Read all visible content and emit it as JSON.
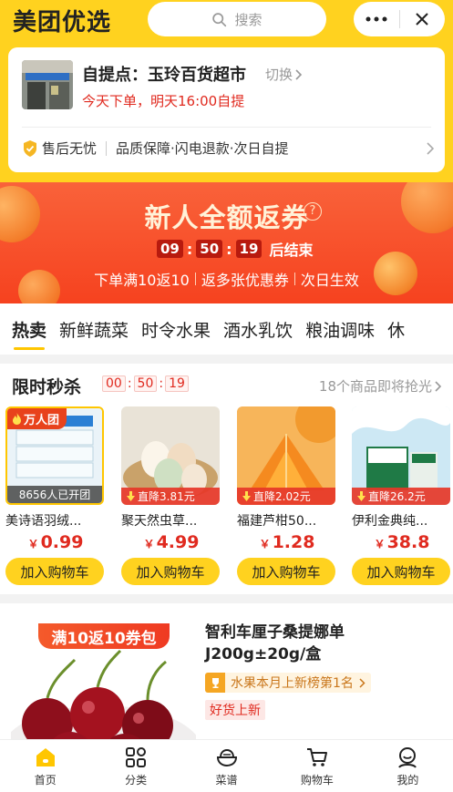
{
  "app": {
    "logo": "美团优选"
  },
  "search": {
    "placeholder": "搜索"
  },
  "pickup": {
    "title": "自提点：玉玲百货超市",
    "switch_label": "切换",
    "time_text": "今天下单，明天16:00自提"
  },
  "guarantee": {
    "label": "售后无忧",
    "detail": "品质保障·闪电退款·次日自提"
  },
  "banner": {
    "title": "新人全额返券",
    "help": "?",
    "countdown": {
      "h": "09",
      "m": "50",
      "s": "19",
      "end_label": "后结束"
    },
    "sub": [
      "下单满10返10",
      "返多张优惠券",
      "次日生效"
    ]
  },
  "tabs": [
    {
      "label": "热卖",
      "active": true
    },
    {
      "label": "新鲜蔬菜"
    },
    {
      "label": "时令水果"
    },
    {
      "label": "酒水乳饮"
    },
    {
      "label": "粮油调味"
    },
    {
      "label": "休"
    }
  ],
  "flash_sale": {
    "title": "限时秒杀",
    "countdown": {
      "h": "00",
      "m": "50",
      "s": "19"
    },
    "more_text": "18个商品即将抢光",
    "products": [
      {
        "name": "美诗语羽绒...",
        "price": "0.99",
        "tag": "8656人已开团",
        "group_badge": "万人团",
        "add_label": "加入购物车"
      },
      {
        "name": "聚天然虫草...",
        "price": "4.99",
        "tag": "直降3.81元",
        "add_label": "加入购物车"
      },
      {
        "name": "福建芦柑50...",
        "price": "1.28",
        "tag": "直降2.02元",
        "add_label": "加入购物车"
      },
      {
        "name": "伊利金典纯...",
        "price": "38.8",
        "tag": "直降26.2元",
        "add_label": "加入购物车"
      }
    ],
    "currency": "￥"
  },
  "featured": {
    "badge": "满10返10券包",
    "title": "智利车厘子桑提娜单J200g±20g/盒",
    "rank_text": "水果本月上新榜第1名",
    "tag": "好货上新"
  },
  "bottom_nav": [
    {
      "label": "首页",
      "active": true
    },
    {
      "label": "分类"
    },
    {
      "label": "菜谱"
    },
    {
      "label": "购物车"
    },
    {
      "label": "我的"
    }
  ],
  "colors": {
    "brand_yellow": "#ffd21f",
    "banner_red": "#f6421f",
    "price_red": "#e02a1f"
  }
}
